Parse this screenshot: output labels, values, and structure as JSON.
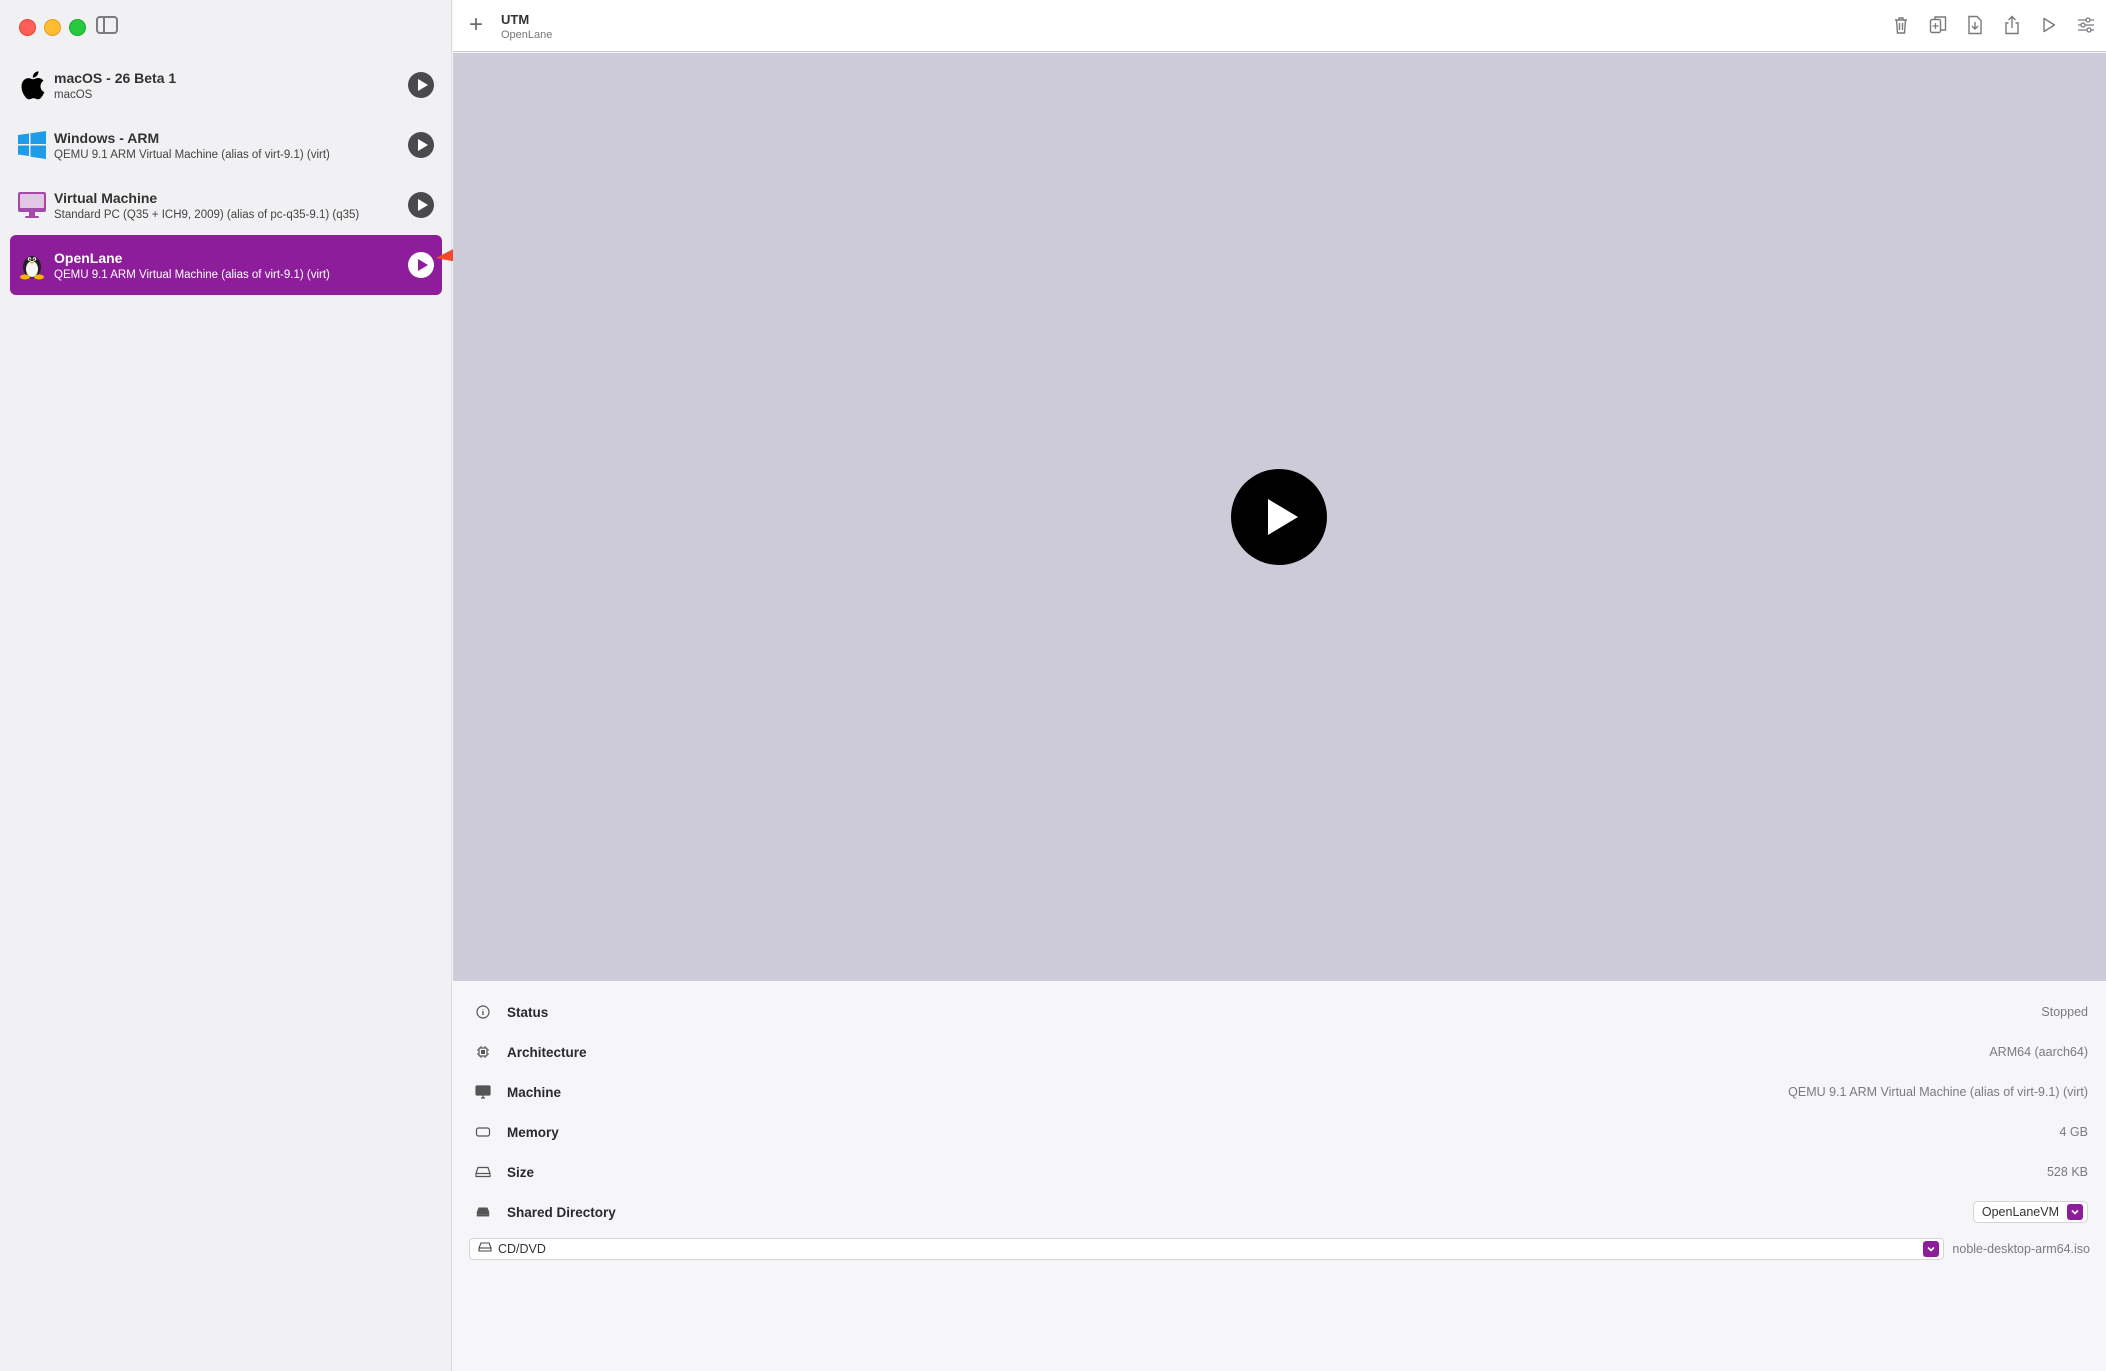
{
  "window": {
    "title": "UTM",
    "subtitle": "OpenLane"
  },
  "sidebar": {
    "items": [
      {
        "name": "macOS - 26 Beta 1",
        "desc": "macOS",
        "icon": "apple-icon"
      },
      {
        "name": "Windows - ARM",
        "desc": "QEMU 9.1 ARM Virtual Machine (alias of virt-9.1) (virt)",
        "icon": "windows-icon"
      },
      {
        "name": "Virtual Machine",
        "desc": "Standard PC (Q35 + ICH9, 2009) (alias of pc-q35-9.1) (q35)",
        "icon": "monitor-icon"
      },
      {
        "name": "OpenLane",
        "desc": "QEMU 9.1 ARM Virtual Machine (alias of virt-9.1) (virt)",
        "icon": "linux-icon",
        "selected": true
      }
    ]
  },
  "toolbar": {
    "icons": [
      "trash-icon",
      "clone-icon",
      "export-icon",
      "share-icon",
      "run-icon",
      "settings-icon"
    ]
  },
  "details": {
    "status": {
      "label": "Status",
      "value": "Stopped"
    },
    "architecture": {
      "label": "Architecture",
      "value": "ARM64 (aarch64)"
    },
    "machine": {
      "label": "Machine",
      "value": "QEMU 9.1 ARM Virtual Machine (alias of virt-9.1) (virt)"
    },
    "memory": {
      "label": "Memory",
      "value": "4 GB"
    },
    "size": {
      "label": "Size",
      "value": "528 KB"
    },
    "shared_directory": {
      "label": "Shared Directory",
      "value": "OpenLaneVM"
    },
    "cd_dvd": {
      "label": "CD/DVD",
      "value": "noble-desktop-arm64.iso"
    }
  },
  "colors": {
    "accent": "#8e1d9b",
    "preview_bg": "#cecbd8",
    "annotation_arrow": "#f0492a"
  }
}
